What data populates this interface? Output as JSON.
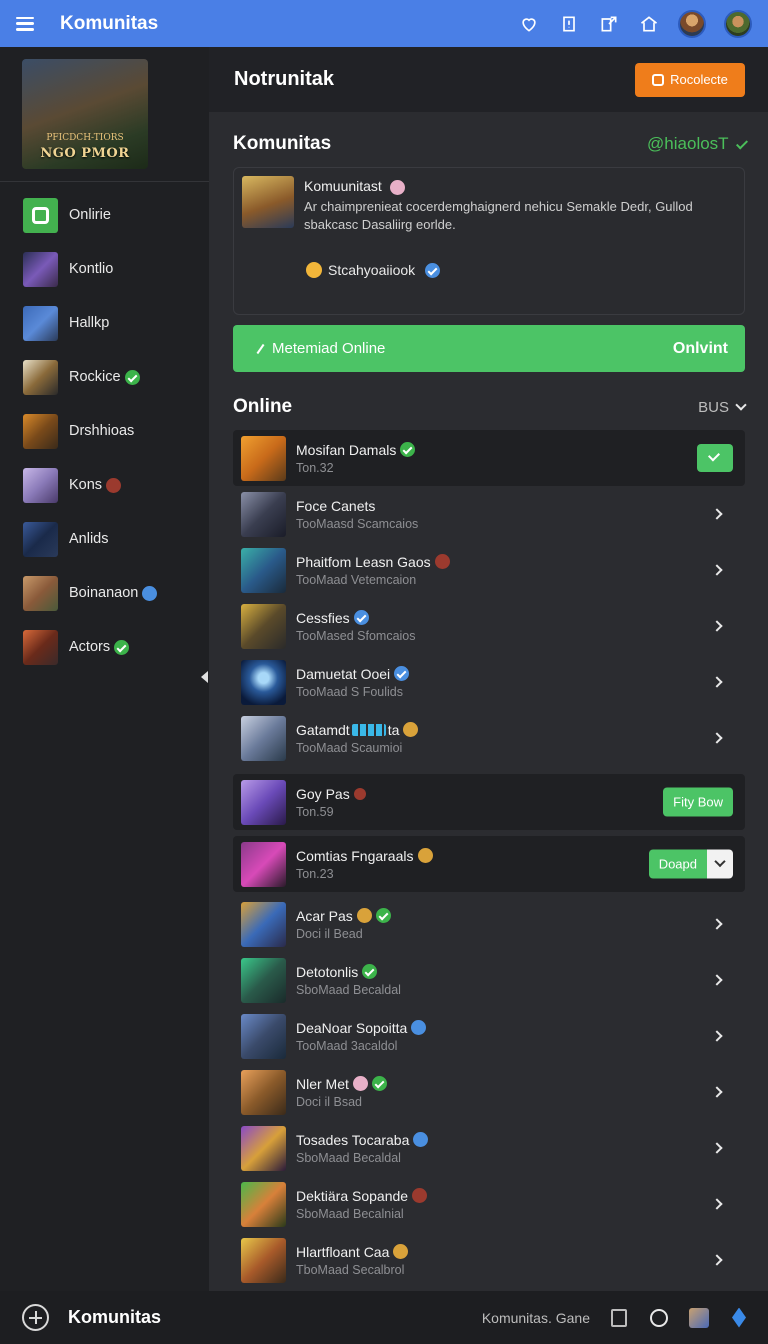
{
  "topbar": {
    "title": "Komunitas",
    "icons": [
      "menu-icon",
      "heart-icon",
      "notification-icon",
      "share-icon",
      "home-icon",
      "profile-avatar"
    ]
  },
  "sidebar": {
    "banner_text": "NGO PMOR",
    "banner_sub": "PFICDCH-TIORS",
    "items": [
      {
        "label": "Onlirie",
        "badge": ""
      },
      {
        "label": "Kontlio",
        "badge": ""
      },
      {
        "label": "Hallkp",
        "badge": ""
      },
      {
        "label": "Rockice",
        "badge": "green"
      },
      {
        "label": "Drshhioas",
        "badge": ""
      },
      {
        "label": "Kons",
        "badge": "red"
      },
      {
        "label": "Anlids",
        "badge": ""
      },
      {
        "label": "Boinanaon",
        "badge": "blue"
      },
      {
        "label": "Actors",
        "badge": "green"
      }
    ]
  },
  "main": {
    "header_title": "Notrunitak",
    "header_button": "Rocolecte",
    "section_title": "Komunitas",
    "user_tag": "@hiaolosT",
    "post": {
      "title": "Komuunitast",
      "body": "Ar chaimprenieat cocerdemghaignerd nehicu Semakle Dedr, Gullod sbakcasc Dasaliirg eorlde.",
      "author": "Stcahyoaiiook"
    },
    "green_bar": {
      "left": "Metemiad Online",
      "right": "Onlvint"
    },
    "online_title": "Online",
    "filter_label": "BUS",
    "rows": [
      {
        "name": "Mosifan Damals",
        "sub": "Ton.32",
        "badge": "green",
        "action": "check"
      },
      {
        "name": "Foce Canets",
        "sub": "TooMaasd Scamcaios",
        "badge": "",
        "action": "chevron"
      },
      {
        "name": "Phaitfom Leasn Gaos",
        "sub": "TooMaad Vetemcaion",
        "badge": "red",
        "action": "chevron"
      },
      {
        "name": "Cessfies",
        "sub": "TooMased Sfomcaios",
        "badge": "blue",
        "action": "chevron"
      },
      {
        "name": "Damuetat Ooei",
        "sub": "TooMaad S Foulids",
        "badge": "blue",
        "action": "chevron"
      },
      {
        "name": "Gatamdt",
        "name_tail": "ta",
        "sub": "TooMaad Scaumioi",
        "badge": "gold",
        "action": "chevron"
      },
      {
        "name": "Goy Pas",
        "sub": "Ton.59",
        "badge": "red",
        "action": "button",
        "button": "Fity Bow"
      },
      {
        "name": "Comtias Fngaraals",
        "sub": "Ton.23",
        "badge": "gold",
        "action": "split",
        "button": "Doapd"
      },
      {
        "name": "Acar Pas",
        "sub": "Doci il Bead",
        "badge": "green",
        "action": "chevron"
      },
      {
        "name": "Detotonlis",
        "sub": "SboMaad Becaldal",
        "badge": "green",
        "action": "chevron"
      },
      {
        "name": "DeaNoar Sopoitta",
        "sub": "TooMaad 3acaldol",
        "badge": "blue",
        "action": "chevron"
      },
      {
        "name": "Nler Met",
        "sub": "Doci il Bsad",
        "badge": "green",
        "action": "chevron"
      },
      {
        "name": "Tosades Tocaraba",
        "sub": "SboMaad Becaldal",
        "badge": "blue",
        "action": "chevron"
      },
      {
        "name": "Dektiära Sopande",
        "sub": "SboMaad Becalnial",
        "badge": "red",
        "action": "chevron"
      },
      {
        "name": "Hlartfloant Caa",
        "sub": "TboMaad Secalbrol",
        "badge": "gold",
        "action": "chevron"
      }
    ]
  },
  "bottombar": {
    "title": "Komunitas",
    "right_text": "Komunitas. Gane"
  },
  "colors": {
    "accent_blue": "#4a7fe6",
    "accent_green": "#4cc466",
    "accent_orange": "#ef7d1b"
  }
}
